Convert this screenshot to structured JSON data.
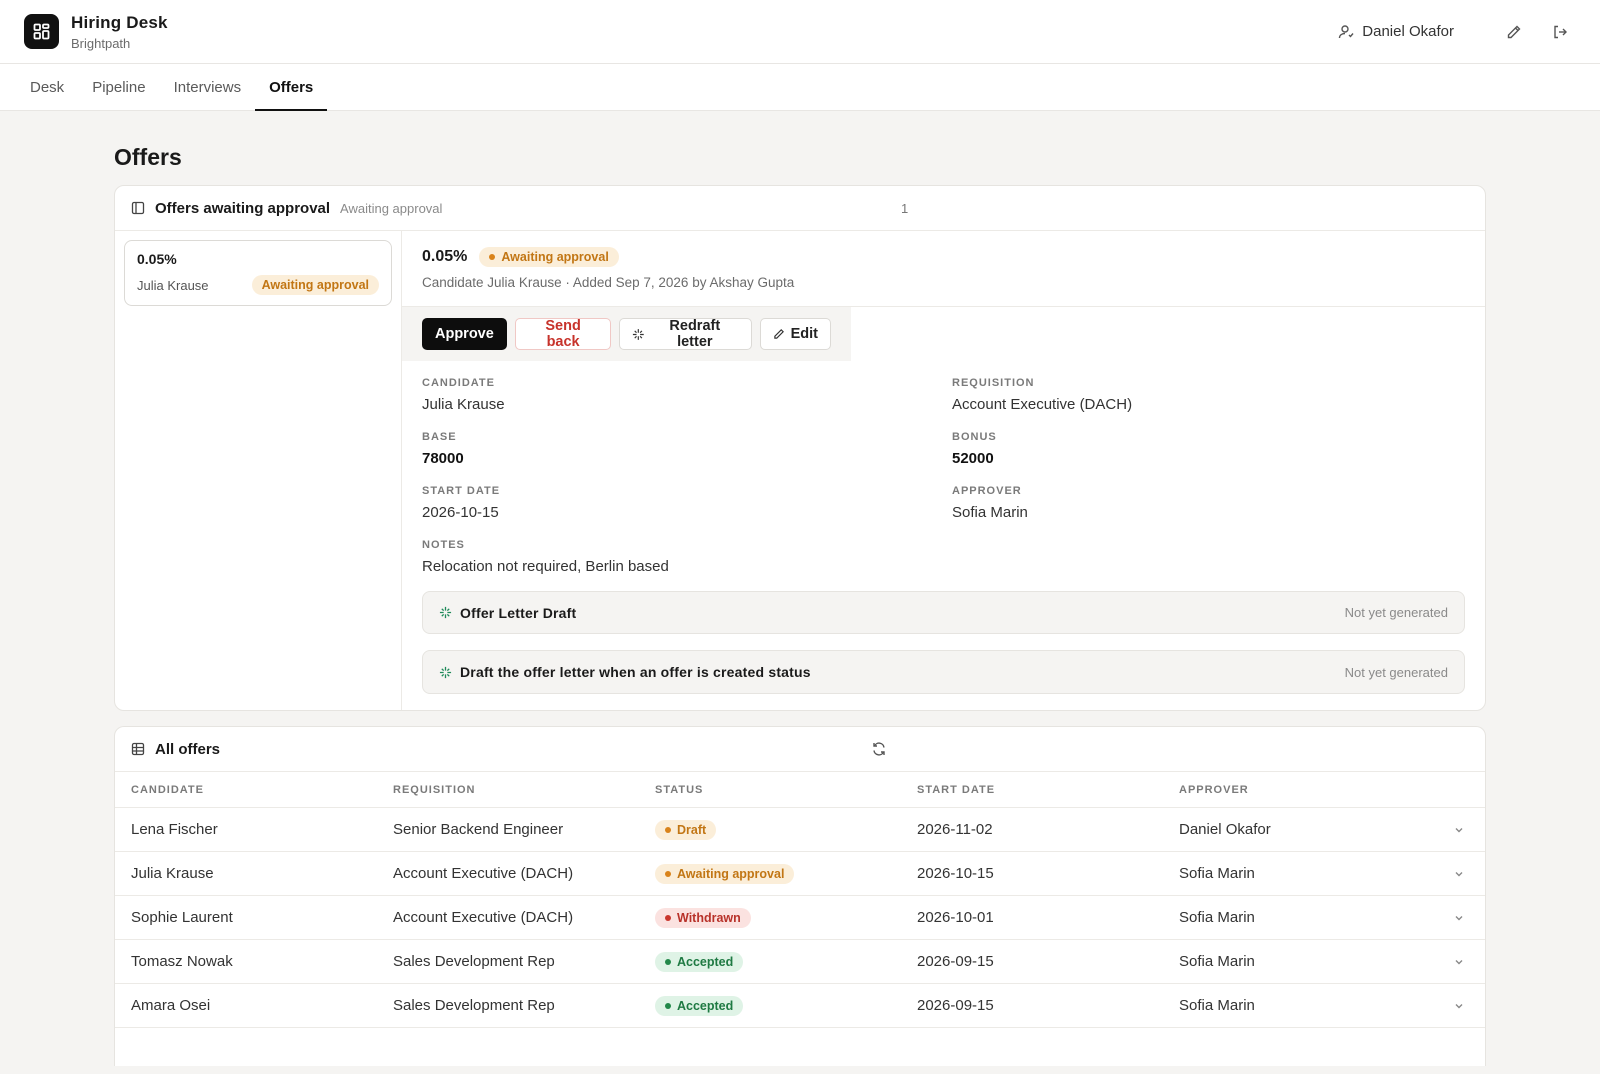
{
  "app": {
    "title": "Hiring Desk",
    "org": "Brightpath"
  },
  "user": {
    "name": "Daniel Okafor"
  },
  "nav": {
    "tabs": [
      {
        "label": "Desk"
      },
      {
        "label": "Pipeline"
      },
      {
        "label": "Interviews"
      },
      {
        "label": "Offers"
      }
    ],
    "active": "Offers"
  },
  "page": {
    "title": "Offers"
  },
  "approval": {
    "title": "Offers awaiting approval",
    "subtitle": "Awaiting approval",
    "count": "1",
    "list": [
      {
        "pct": "0.05%",
        "name": "Julia Krause",
        "status": "Awaiting approval"
      }
    ],
    "detail": {
      "pct": "0.05%",
      "status": "Awaiting approval",
      "meta": "Candidate Julia Krause  ·  Added Sep 7, 2026 by Akshay Gupta",
      "actions": {
        "approve": "Approve",
        "send_back": "Send back",
        "redraft": "Redraft letter",
        "edit": "Edit"
      },
      "fields": {
        "candidate_label": "CANDIDATE",
        "candidate": "Julia Krause",
        "requisition_label": "REQUISITION",
        "requisition": "Account Executive (DACH)",
        "base_label": "BASE",
        "base": "78000",
        "bonus_label": "BONUS",
        "bonus": "52000",
        "start_label": "START DATE",
        "start": "2026-10-15",
        "approver_label": "APPROVER",
        "approver": "Sofia Marin",
        "notes_label": "NOTES",
        "notes": "Relocation not required, Berlin based"
      },
      "generated": [
        {
          "title": "Offer Letter Draft",
          "status": "Not yet generated"
        },
        {
          "title": "Draft the offer letter when an offer is created status",
          "status": "Not yet generated"
        }
      ]
    }
  },
  "all_offers": {
    "title": "All offers",
    "columns": [
      "CANDIDATE",
      "REQUISITION",
      "STATUS",
      "START DATE",
      "APPROVER"
    ],
    "rows": [
      {
        "candidate": "Lena Fischer",
        "requisition": "Senior Backend Engineer",
        "status": "Draft",
        "start": "2026-11-02",
        "approver": "Daniel Okafor"
      },
      {
        "candidate": "Julia Krause",
        "requisition": "Account Executive (DACH)",
        "status": "Awaiting approval",
        "start": "2026-10-15",
        "approver": "Sofia Marin"
      },
      {
        "candidate": "Sophie Laurent",
        "requisition": "Account Executive (DACH)",
        "status": "Withdrawn",
        "start": "2026-10-01",
        "approver": "Sofia Marin"
      },
      {
        "candidate": "Tomasz Nowak",
        "requisition": "Sales Development Rep",
        "status": "Accepted",
        "start": "2026-09-15",
        "approver": "Sofia Marin"
      },
      {
        "candidate": "Amara Osei",
        "requisition": "Sales Development Rep",
        "status": "Accepted",
        "start": "2026-09-15",
        "approver": "Sofia Marin"
      }
    ]
  },
  "colors": {
    "accent": "#111111",
    "awaiting": "#c27614",
    "withdrawn": "#b8322a",
    "accepted": "#1f7a43",
    "sparkle": "#1f8a5a"
  }
}
